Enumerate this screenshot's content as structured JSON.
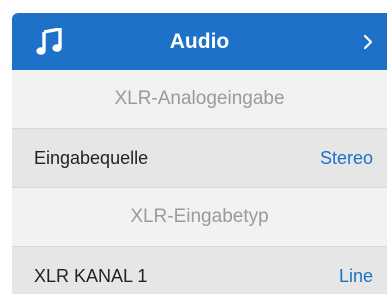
{
  "header": {
    "icon": "music-note-icon",
    "title": "Audio",
    "chevron": "chevron-right-icon",
    "accent_color": "#1d71c9"
  },
  "rows": [
    {
      "type": "section",
      "label": "XLR-Analogeingabe"
    },
    {
      "type": "setting",
      "label": "Eingabequelle",
      "value": "Stereo"
    },
    {
      "type": "section",
      "label": "XLR-Eingabetyp"
    },
    {
      "type": "setting",
      "label": "XLR KANAL 1",
      "value": "Line"
    }
  ]
}
